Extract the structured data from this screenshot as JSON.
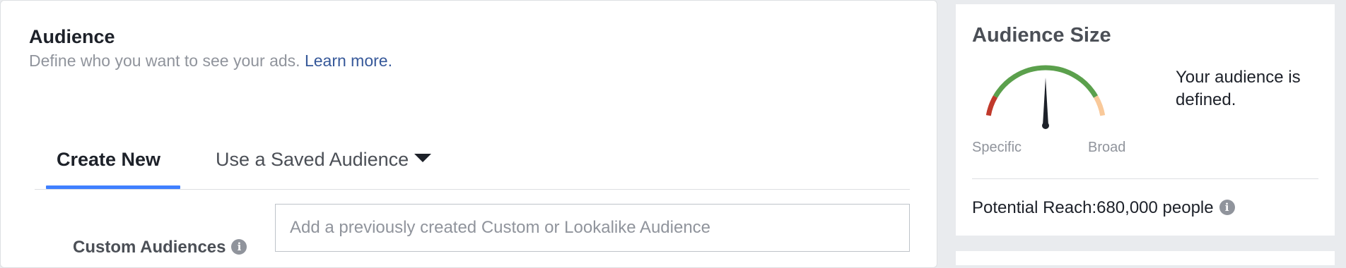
{
  "audience": {
    "title": "Audience",
    "subtitle": "Define who you want to see your ads.",
    "learn_more": "Learn more.",
    "tabs": [
      {
        "label": "Create New",
        "active": true
      },
      {
        "label": "Use a Saved Audience",
        "active": false
      }
    ],
    "custom_audiences": {
      "label": "Custom Audiences",
      "placeholder": "Add a previously created Custom or Lookalike Audience",
      "value": ""
    }
  },
  "audience_size": {
    "title": "Audience Size",
    "gauge_left_label": "Specific",
    "gauge_right_label": "Broad",
    "gauge_level": 0.5,
    "status_text": "Your audience is defined.",
    "reach_label": "Potential Reach:",
    "reach_value": "680,000 people"
  },
  "colors": {
    "accent": "#4080ff",
    "link": "#365899",
    "gauge_specific": "#c0392b",
    "gauge_defined": "#5ba04c",
    "gauge_broad": "#f9c99a"
  },
  "icons": {
    "info": "info-icon",
    "caret": "caret-down-icon"
  }
}
